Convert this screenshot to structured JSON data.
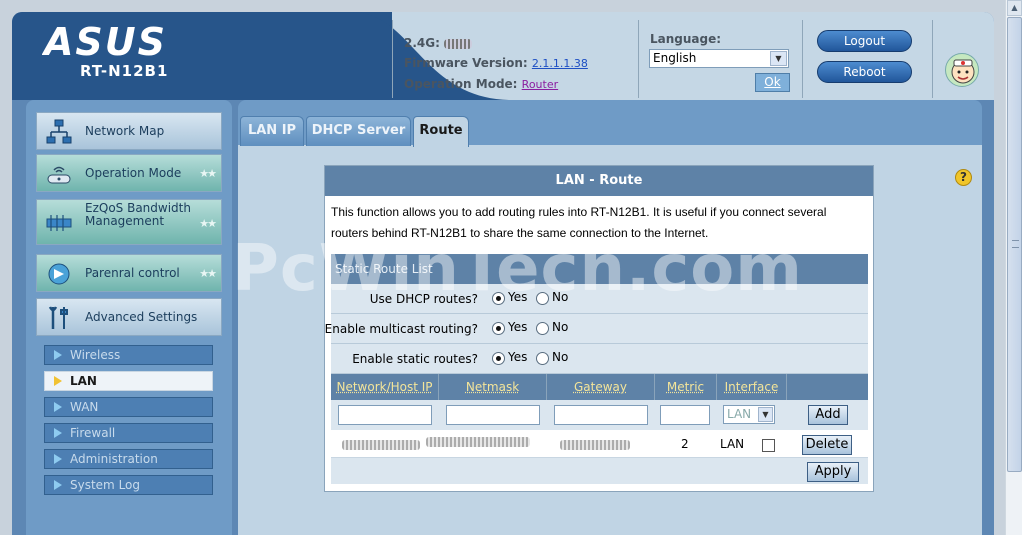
{
  "header": {
    "brand": "ASUS",
    "model": "RT-N12B1",
    "band_label": "2.4G:",
    "firmware_label": "Firmware Version:",
    "firmware_value": "2.1.1.1.38",
    "opmode_label": "Operation Mode:",
    "opmode_value": "Router",
    "language_label": "Language:",
    "language_value": "English",
    "ok_label": "Ok",
    "logout_label": "Logout",
    "reboot_label": "Reboot"
  },
  "sidebar": {
    "items": [
      {
        "label": "Network Map"
      },
      {
        "label": "Operation Mode"
      },
      {
        "label": "EzQoS Bandwidth Management"
      },
      {
        "label": "Parenral control"
      },
      {
        "label": "Advanced Settings"
      }
    ],
    "stars": "★★",
    "subitems": [
      {
        "label": "Wireless"
      },
      {
        "label": "LAN"
      },
      {
        "label": "WAN"
      },
      {
        "label": "Firewall"
      },
      {
        "label": "Administration"
      },
      {
        "label": "System Log"
      }
    ]
  },
  "tabs": [
    {
      "label": "LAN IP"
    },
    {
      "label": "DHCP Server"
    },
    {
      "label": "Route"
    }
  ],
  "panel": {
    "title": "LAN - Route",
    "description_line1": "This function allows you to add routing rules into RT-N12B1. It is useful if you connect several",
    "description_line2": "routers behind RT-N12B1 to share the same connection to the Internet.",
    "list_title": "Static Route List",
    "options": [
      {
        "label": "Use DHCP routes?",
        "yes": "Yes",
        "no": "No"
      },
      {
        "label": "Enable multicast routing?",
        "yes": "Yes",
        "no": "No"
      },
      {
        "label": "Enable static routes?",
        "yes": "Yes",
        "no": "No"
      }
    ],
    "columns": [
      "Network/Host IP",
      "Netmask",
      "Gateway",
      "Metric",
      "Interface"
    ],
    "interface_select": "LAN",
    "add_label": "Add",
    "row": {
      "metric": "2",
      "interface": "LAN",
      "delete_label": "Delete"
    },
    "apply_label": "Apply"
  },
  "help_label": "?",
  "watermark": "PcWinTech.com"
}
